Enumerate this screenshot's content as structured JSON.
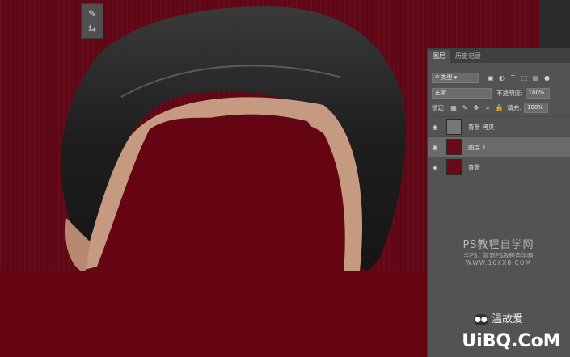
{
  "canvas": {
    "background_color": "#5e0815",
    "fill_color": "#650513"
  },
  "tools": {
    "brush_icon": "brush-icon",
    "adjust_icon": "adjust-icon"
  },
  "panel": {
    "tabs": [
      "图层",
      "历史记录"
    ],
    "filter": {
      "label": "类型",
      "icons": [
        "image-icon",
        "adjustment-icon",
        "text-icon",
        "shape-icon",
        "smart-object-icon",
        "dot-icon"
      ]
    },
    "blend_mode": "正常",
    "opacity_label": "不透明度:",
    "opacity_value": "100%",
    "lock_label": "锁定:",
    "fill_label": "填充:",
    "fill_value": "100%",
    "layers": [
      {
        "name": "背景 拷贝",
        "visible": true,
        "selected": false
      },
      {
        "name": "图层 1",
        "visible": true,
        "selected": true
      },
      {
        "name": "背景",
        "visible": true,
        "selected": false
      }
    ]
  },
  "watermark": {
    "title": "PS教程自学网",
    "subtitle": "学PS，就到PS教程自学网",
    "url": "WWW.16XX8.COM",
    "wechat_name": "温故爱",
    "logo_text": "UiBQ.CoM"
  }
}
